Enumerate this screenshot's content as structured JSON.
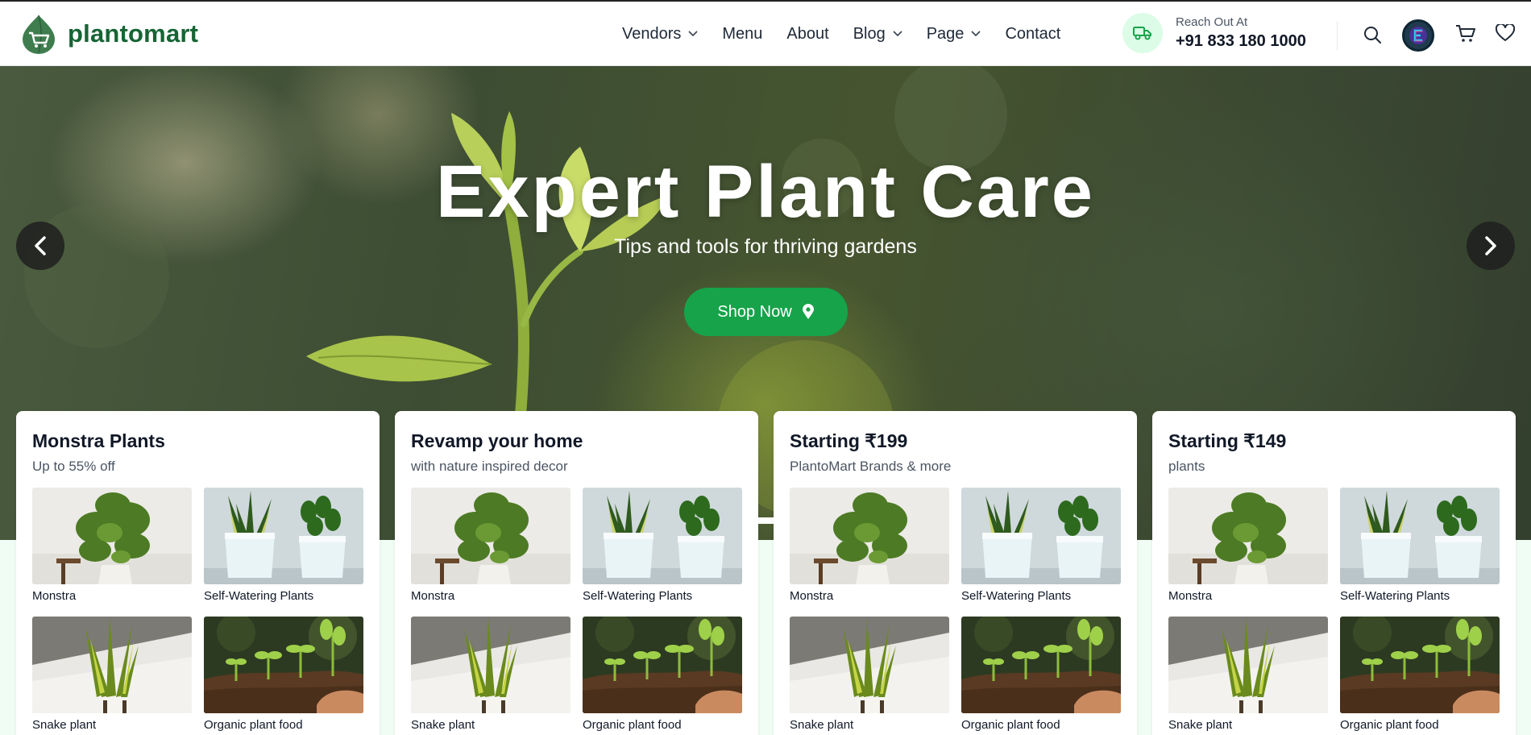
{
  "brand": {
    "name": "plantomart"
  },
  "nav": {
    "items": [
      {
        "label": "Vendors",
        "dropdown": true
      },
      {
        "label": "Menu",
        "dropdown": false
      },
      {
        "label": "About",
        "dropdown": false
      },
      {
        "label": "Blog",
        "dropdown": true
      },
      {
        "label": "Page",
        "dropdown": true
      },
      {
        "label": "Contact",
        "dropdown": false
      }
    ]
  },
  "contact": {
    "label": "Reach Out At",
    "phone": "+91 833 180 1000",
    "icon": "truck-icon"
  },
  "header_icons": [
    "search-icon",
    "avatar",
    "cart-icon",
    "heart-icon"
  ],
  "hero": {
    "title": "Expert Plant Care",
    "subtitle": "Tips and tools for thriving gardens",
    "cta_label": "Shop Now",
    "slides": 2,
    "active_slide": 2
  },
  "cards": [
    {
      "title": "Monstra Plants",
      "subtitle": "Up to 55% off",
      "items": [
        "Monstra",
        "Self-Watering Plants",
        "Snake plant",
        "Organic plant food"
      ]
    },
    {
      "title": "Revamp your home",
      "subtitle": "with nature inspired decor",
      "items": [
        "Monstra",
        "Self-Watering Plants",
        "Snake plant",
        "Organic plant food"
      ]
    },
    {
      "title": "Starting ₹199",
      "subtitle": "PlantoMart Brands & more",
      "items": [
        "Monstra",
        "Self-Watering Plants",
        "Snake plant",
        "Organic plant food"
      ]
    },
    {
      "title": "Starting ₹149",
      "subtitle": "plants",
      "items": [
        "Monstra",
        "Self-Watering Plants",
        "Snake plant",
        "Organic plant food"
      ]
    }
  ],
  "colors": {
    "brand_green": "#166534",
    "cta_green": "#16a34a",
    "section_bg": "#f0fdf4"
  }
}
